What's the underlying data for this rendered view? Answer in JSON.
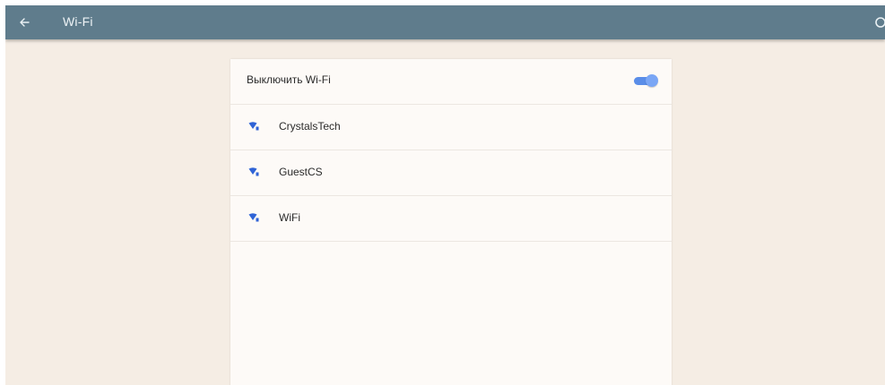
{
  "appbar": {
    "title": "Wi-Fi",
    "background_color": "#5f7c8c",
    "back_icon": "arrow-back-icon",
    "overflow_icon": "overflow-icon"
  },
  "wifi_toggle": {
    "label": "Выключить Wi-Fi",
    "state": "on",
    "accent_color": "#5a8de8"
  },
  "networks": [
    {
      "name": "CrystalsTech",
      "icon": "wifi-signal-icon"
    },
    {
      "name": "GuestCS",
      "icon": "wifi-signal-icon"
    },
    {
      "name": "WiFi",
      "icon": "wifi-signal-icon"
    }
  ]
}
